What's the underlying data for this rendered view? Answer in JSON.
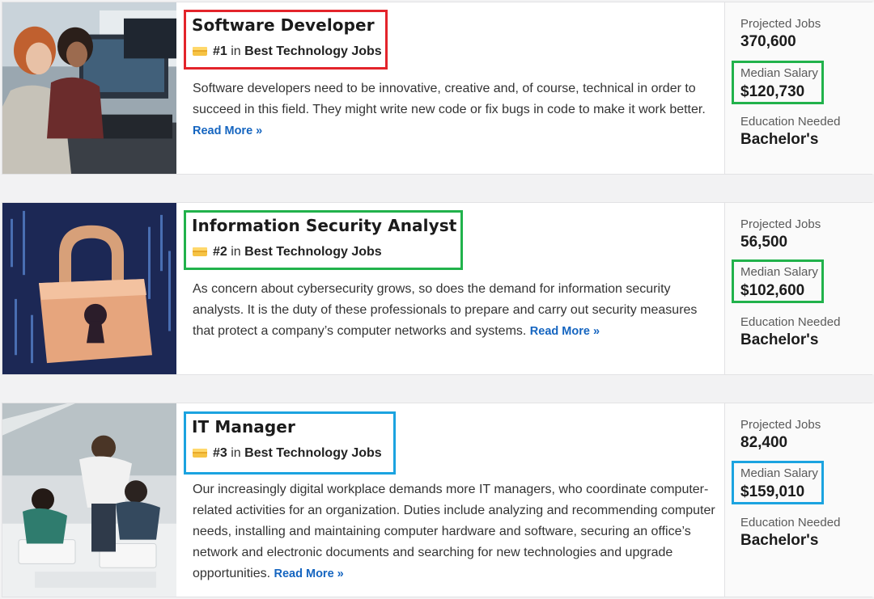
{
  "colors": {
    "highlight_red": "#e3242b",
    "highlight_green": "#21b24b",
    "highlight_blue": "#1ba3e0",
    "link": "#1565c0"
  },
  "stat_labels": {
    "projected": "Projected Jobs",
    "salary": "Median Salary",
    "education": "Education Needed"
  },
  "jobs": [
    {
      "title": "Software Developer",
      "rank": "#1",
      "rank_in": "in",
      "rank_category": "Best Technology Jobs",
      "description": "Software developers need to be innovative, creative and, of course, technical in order to succeed in this field. They might write new code or fix bugs in code to make it work better.",
      "read_more": "Read More »",
      "projected_jobs": "370,600",
      "median_salary": "$120,730",
      "education": "Bachelor's",
      "image_icon": "developers-at-computer-photo"
    },
    {
      "title": "Information Security Analyst",
      "rank": "#2",
      "rank_in": "in",
      "rank_category": "Best Technology Jobs",
      "description": "As concern about cybersecurity grows, so does the demand for information security analysts. It is the duty of these professionals to prepare and carry out security measures that protect a company’s computer networks and systems.",
      "read_more": "Read More »",
      "projected_jobs": "56,500",
      "median_salary": "$102,600",
      "education": "Bachelor's",
      "image_icon": "digital-padlock-photo"
    },
    {
      "title": "IT Manager",
      "rank": "#3",
      "rank_in": "in",
      "rank_category": "Best Technology Jobs",
      "description": "Our increasingly digital workplace demands more IT managers, who coordinate computer-related activities for an organization. Duties include analyzing and recommending computer needs, installing and maintaining computer hardware and software, securing an office’s network and electronic documents and searching for new technologies and upgrade opportunities.",
      "read_more": "Read More »",
      "projected_jobs": "82,400",
      "median_salary": "$159,010",
      "education": "Bachelor's",
      "image_icon": "team-at-desk-overhead-photo"
    }
  ]
}
